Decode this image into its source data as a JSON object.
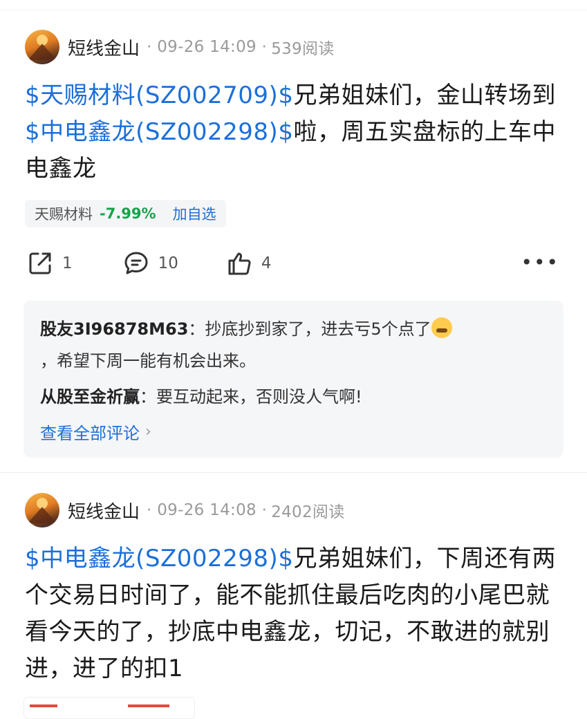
{
  "post1": {
    "author": "短线金山",
    "time": "· 09-26 14:09 ·",
    "reads": "539阅读",
    "stock_tag_1": "$天赐材料(SZ002709)$",
    "text_1": "兄弟姐妹们，金山转场到",
    "stock_tag_2": "$中电鑫龙(SZ002298)$",
    "text_2": "啦，周五实盘标的上车中电鑫龙",
    "chip": {
      "name": "天赐材料",
      "change": "-7.99%",
      "add": "加自选"
    },
    "actions": {
      "share": "1",
      "comment": "10",
      "like": "4"
    },
    "comments": [
      {
        "name": "股友3I96878M63",
        "sep": "：",
        "text": "抄底抄到家了，进去亏5个点了",
        "text_after": "，希望下周一能有机会出来。"
      },
      {
        "name": "从股至金祈赢",
        "sep": "：",
        "text": "要互动起来，否则没人气啊!"
      }
    ],
    "view_all": "查看全部评论"
  },
  "post2": {
    "author": "短线金山",
    "time": "· 09-26 14:08 ·",
    "reads": "2402阅读",
    "stock_tag_1": "$中电鑫龙(SZ002298)$",
    "text_1": "兄弟姐妹们，下周还有两个交易日时间了，能不能抓住最后吃肉的小尾巴就看今天的了，抄底中电鑫龙，切记，不敢进的就别进，进了的扣1"
  },
  "colors": {
    "link": "#1c6fd9",
    "down": "#16a34a"
  },
  "icons": [
    "share-icon",
    "comment-icon",
    "like-icon",
    "more-icon",
    "chevron-right-icon",
    "crying-emoji-icon"
  ]
}
